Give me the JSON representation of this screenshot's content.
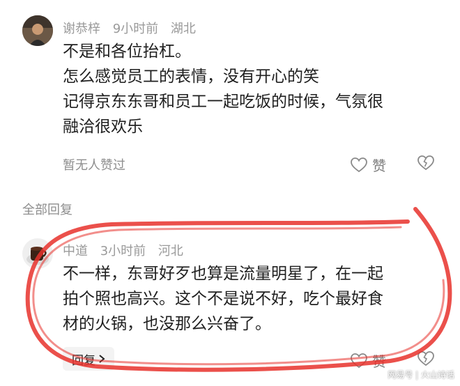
{
  "comment1": {
    "author": "谢恭梓",
    "time": "9小时前",
    "location": "湖北",
    "lines": [
      "不是和各位抬杠。",
      "怎么感觉员工的表情，没有开心的笑",
      "记得京东东哥和员工一起吃饭的时候，气氛很",
      "融洽很欢乐"
    ],
    "no_likes_text": "暂无人赞过",
    "like_label": "赞"
  },
  "replies_header": "全部回复",
  "comment2": {
    "author": "中道",
    "time": "3小时前",
    "location": "河北",
    "lines": [
      "不一样，东哥好歹也算是流量明星了，在一起",
      "拍个照也高兴。这个不是说不好，吃个最好食",
      "材的火锅，也没那么兴奋了。"
    ],
    "reply_label": "回复",
    "like_label": "赞"
  },
  "watermark": "网易号 | 火山诗话",
  "colors": {
    "annotation_red": "#e8312b",
    "meta_gray": "#9a9a9a",
    "body_text": "#1f1f1f"
  }
}
